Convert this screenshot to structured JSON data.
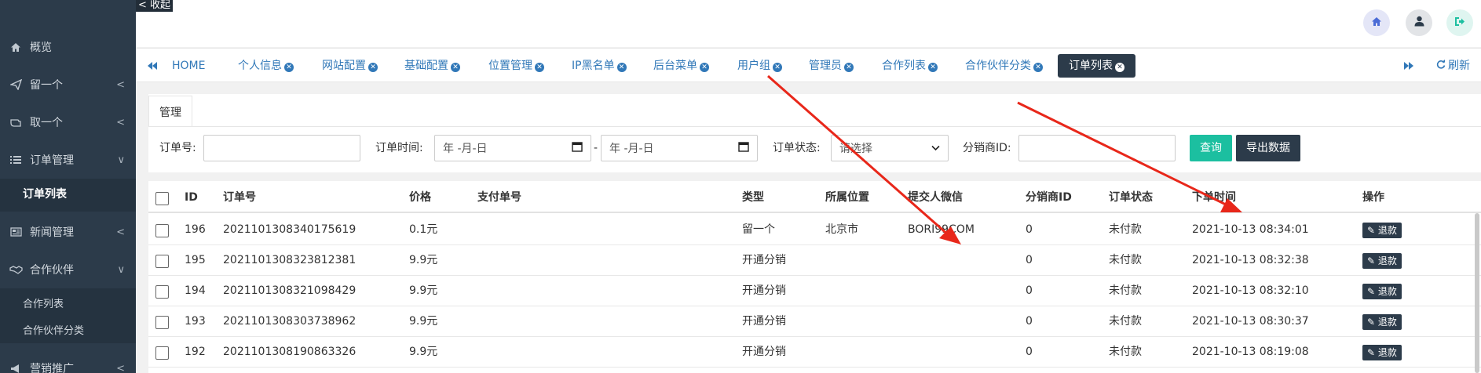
{
  "sidebar": {
    "collapse_label": "< 收起",
    "items": [
      {
        "label": "概览",
        "icon": "home-icon",
        "has_arrow": false
      },
      {
        "label": "留一个",
        "icon": "paper-plane-icon",
        "arrow": "<"
      },
      {
        "label": "取一个",
        "icon": "hand-icon",
        "arrow": "<"
      },
      {
        "label": "订单管理",
        "icon": "list-icon",
        "arrow": "∨"
      },
      {
        "label": "新闻管理",
        "icon": "newspaper-icon",
        "arrow": "<"
      },
      {
        "label": "合作伙伴",
        "icon": "handshake-icon",
        "arrow": "∨"
      },
      {
        "label": "营销推广",
        "icon": "bullhorn-icon",
        "arrow": "<"
      }
    ],
    "order_sub": [
      "订单列表"
    ],
    "partner_sub": [
      "合作列表",
      "合作伙伴分类"
    ]
  },
  "topbar": {
    "icons": [
      "home-icon",
      "user-icon",
      "sign-out-icon"
    ],
    "colors": {
      "home": "#4a6bd6",
      "user": "#2c3b4a",
      "logout": "#1cbfa0"
    }
  },
  "tabs": {
    "prev_icon": "double-left-icon",
    "next_icon": "double-right-icon",
    "refresh_label": "刷新",
    "items": [
      "HOME",
      "个人信息",
      "网站配置",
      "基础配置",
      "位置管理",
      "IP黑名单",
      "后台菜单",
      "用户组",
      "管理员",
      "合作列表",
      "合作伙伴分类",
      "订单列表"
    ]
  },
  "panel": {
    "tab_label": "管理",
    "order_no_label": "订单号:",
    "order_time_label": "订单时间:",
    "date_placeholder": "年 -月-日",
    "date_sep": "-",
    "status_label": "订单状态:",
    "status_value": "请选择",
    "distributor_label": "分销商ID:",
    "search_button": "查询",
    "export_button": "导出数据",
    "colors": {
      "search": "#1cbfa0",
      "export": "#2c3b4a"
    }
  },
  "table": {
    "headers": [
      "ID",
      "订单号",
      "价格",
      "支付单号",
      "类型",
      "所属位置",
      "提交人微信",
      "分销商ID",
      "订单状态",
      "下单时间",
      "操作"
    ],
    "refund_label": "退款",
    "rows": [
      {
        "id": "196",
        "order_no": "2021101308340175619",
        "price": "0.1元",
        "pay_no": "",
        "type": "留一个",
        "location": "北京市",
        "wechat": "BORI99COM",
        "distributor": "0",
        "status": "未付款",
        "time": "2021-10-13 08:34:01"
      },
      {
        "id": "195",
        "order_no": "2021101308323812381",
        "price": "9.9元",
        "pay_no": "",
        "type": "开通分销",
        "location": "",
        "wechat": "",
        "distributor": "0",
        "status": "未付款",
        "time": "2021-10-13 08:32:38"
      },
      {
        "id": "194",
        "order_no": "2021101308321098429",
        "price": "9.9元",
        "pay_no": "",
        "type": "开通分销",
        "location": "",
        "wechat": "",
        "distributor": "0",
        "status": "未付款",
        "time": "2021-10-13 08:32:10"
      },
      {
        "id": "193",
        "order_no": "2021101308303738962",
        "price": "9.9元",
        "pay_no": "",
        "type": "开通分销",
        "location": "",
        "wechat": "",
        "distributor": "0",
        "status": "未付款",
        "time": "2021-10-13 08:30:37"
      },
      {
        "id": "192",
        "order_no": "2021101308190863326",
        "price": "9.9元",
        "pay_no": "",
        "type": "开通分销",
        "location": "",
        "wechat": "",
        "distributor": "0",
        "status": "未付款",
        "time": "2021-10-13 08:19:08"
      }
    ]
  },
  "annotation_color": "#e8271a"
}
